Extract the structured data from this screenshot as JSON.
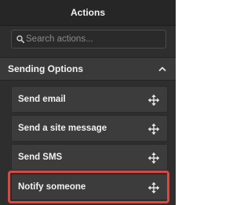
{
  "header": {
    "title": "Actions"
  },
  "search": {
    "placeholder": "Search actions...",
    "value": ""
  },
  "section": {
    "title": "Sending Options",
    "expanded": true
  },
  "items": [
    {
      "label": "Send email"
    },
    {
      "label": "Send a site message"
    },
    {
      "label": "Send SMS"
    },
    {
      "label": "Notify someone",
      "highlighted": true
    }
  ],
  "colors": {
    "panel_bg": "#2e2e2e",
    "item_bg": "#3c3c3c",
    "highlight": "#e0463e",
    "text": "#f2f2f2"
  },
  "icons": {
    "search": "search-icon",
    "collapse": "chevron-up-icon",
    "drag": "move-arrows-icon"
  }
}
